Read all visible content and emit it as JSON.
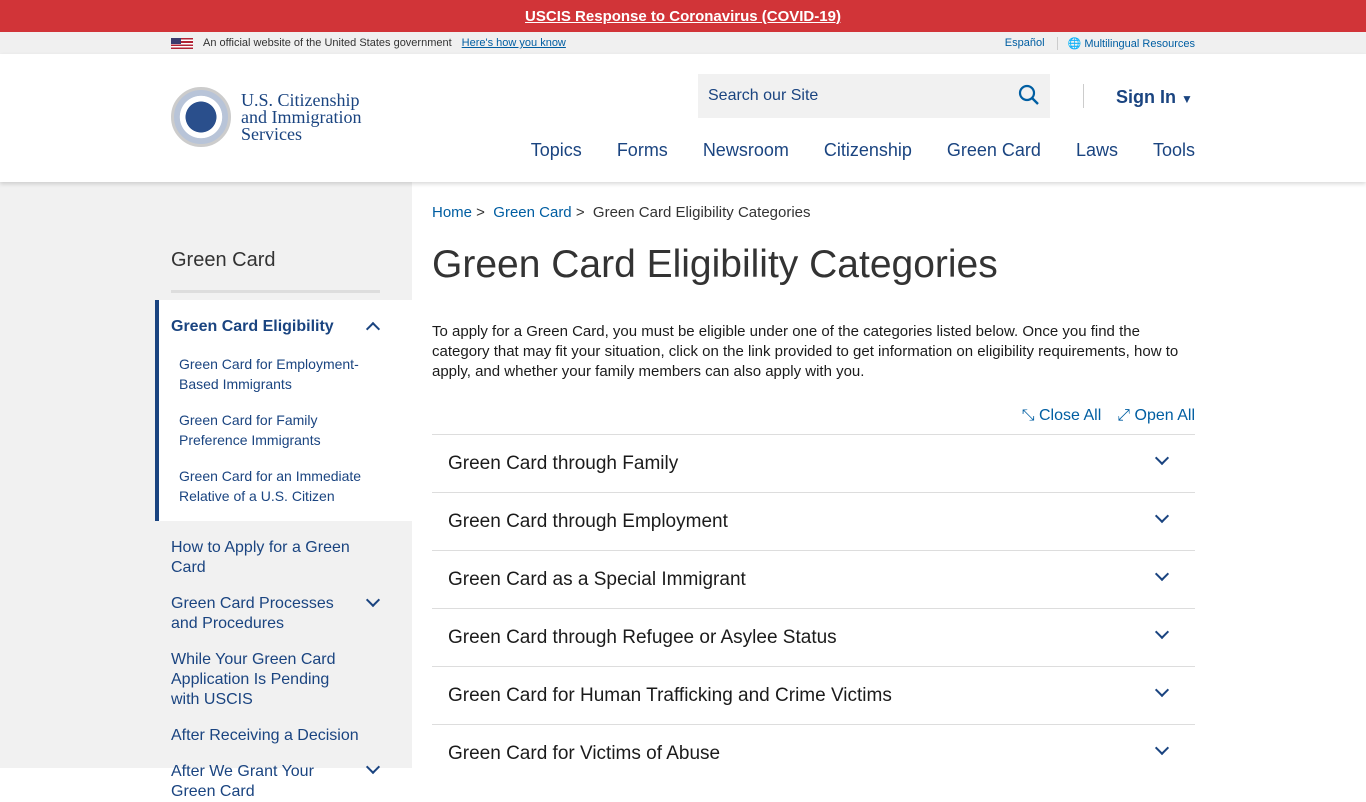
{
  "alert": {
    "text": "USCIS Response to Coronavirus (COVID-19)"
  },
  "govbar": {
    "official": "An official website of the United States government",
    "how": "Here's how you know",
    "espanol": "Español",
    "multilingual": "Multilingual Resources"
  },
  "header": {
    "logo": [
      "U.S. Citizenship",
      "and Immigration",
      "Services"
    ],
    "search_placeholder": "Search our Site",
    "sign_in": "Sign In",
    "nav": [
      "Topics",
      "Forms",
      "Newsroom",
      "Citizenship",
      "Green Card",
      "Laws",
      "Tools"
    ]
  },
  "sidebar": {
    "title": "Green Card",
    "active": {
      "label": "Green Card Eligibility",
      "children": [
        "Green Card for Employment-Based Immigrants",
        "Green Card for Family Preference Immigrants",
        "Green Card for an Immediate Relative of a U.S. Citizen"
      ]
    },
    "items": [
      "How to Apply for a Green Card",
      "Green Card Processes and Procedures",
      "While Your Green Card Application Is Pending with USCIS",
      "After Receiving a Decision",
      "After We Grant Your Green Card"
    ]
  },
  "breadcrumb": [
    "Home",
    "Green Card",
    "Green Card Eligibility Categories"
  ],
  "main": {
    "title": "Green Card Eligibility Categories",
    "intro": "To apply for a Green Card, you must be eligible under one of the categories listed below. Once you find the category that may fit your situation, click on the link provided to get information on eligibility requirements, how to apply, and whether your family members can also apply with you.",
    "close_all": "Close All",
    "open_all": "Open All",
    "accordions": [
      "Green Card through Family",
      "Green Card through Employment",
      "Green Card as a Special Immigrant",
      "Green Card through Refugee or Asylee Status",
      "Green Card for Human Trafficking and Crime Victims",
      "Green Card for Victims of Abuse"
    ]
  }
}
